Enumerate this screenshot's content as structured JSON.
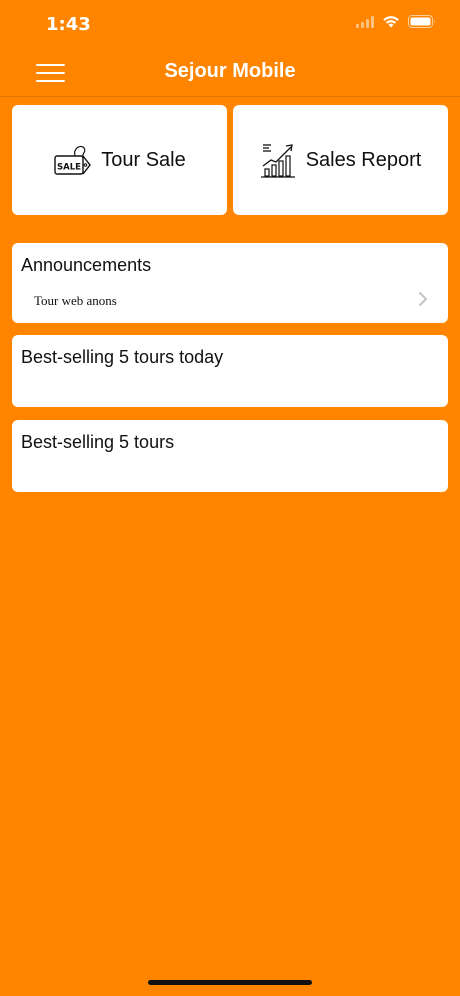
{
  "status_bar": {
    "time": "1:43"
  },
  "nav": {
    "title": "Sejour Mobile"
  },
  "tiles": {
    "tour_sale": {
      "label": "Tour Sale",
      "icon": "sale-tag-icon"
    },
    "sales_report": {
      "label": "Sales Report",
      "icon": "bar-chart-growth-icon"
    }
  },
  "announcements": {
    "title": "Announcements",
    "items": [
      {
        "label": "Tour web anons"
      }
    ]
  },
  "best_today": {
    "title": "Best-selling 5 tours today"
  },
  "best_all": {
    "title": "Best-selling 5 tours"
  },
  "colors": {
    "background": "#FF8500",
    "card": "#FFFFFF"
  }
}
